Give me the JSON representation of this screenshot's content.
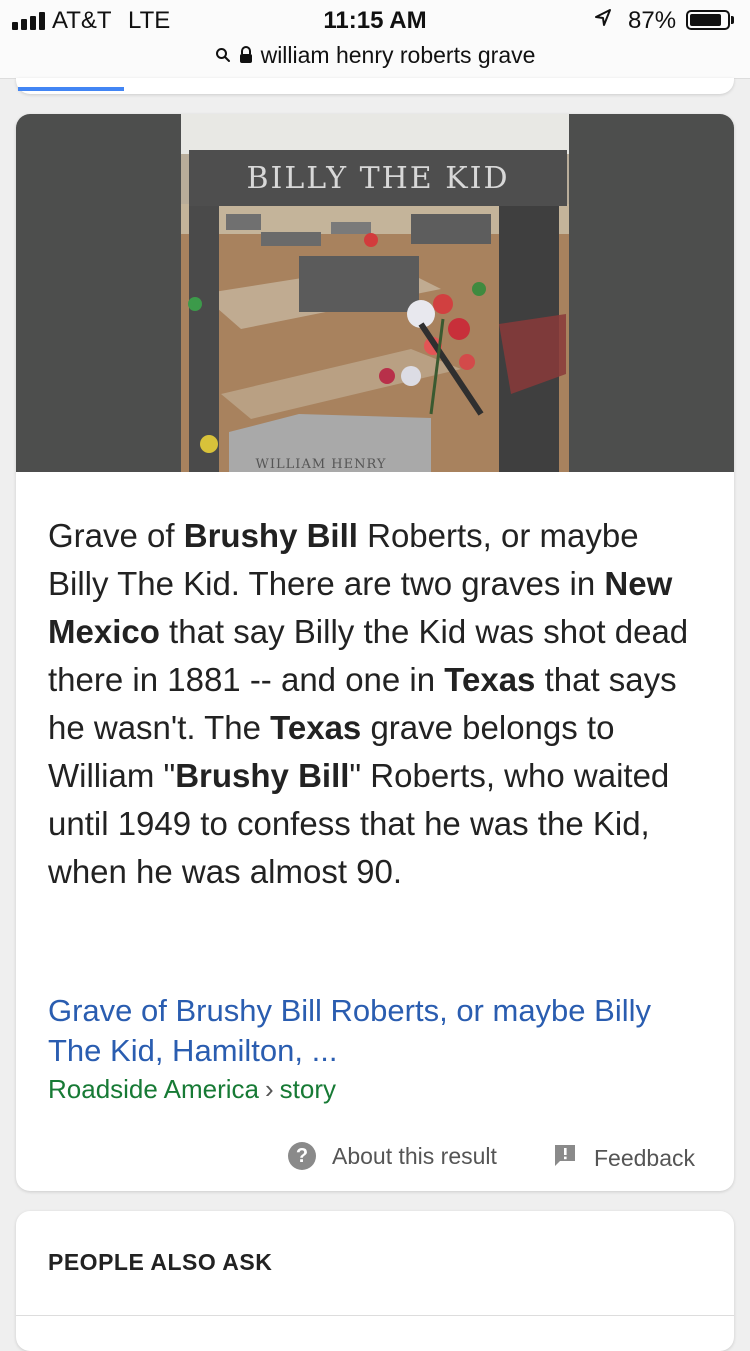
{
  "status_bar": {
    "carrier": "AT&T",
    "network": "LTE",
    "time": "11:15 AM",
    "battery_percent_text": "87%",
    "battery_level": 0.87
  },
  "url_bar": {
    "query": "william henry roberts grave"
  },
  "result": {
    "image": {
      "top_text": "BILLY THE KID",
      "stone_text": "WILLIAM HENRY"
    },
    "snippet": [
      {
        "text": "Grave of ",
        "bold": false
      },
      {
        "text": "Brushy Bill",
        "bold": true
      },
      {
        "text": " Roberts, or maybe Billy The Kid. There are two graves in ",
        "bold": false
      },
      {
        "text": "New Mexico",
        "bold": true
      },
      {
        "text": " that say Billy the Kid was shot dead there in 1881 -- and one in ",
        "bold": false
      },
      {
        "text": "Texas",
        "bold": true
      },
      {
        "text": " that says he wasn't. The ",
        "bold": false
      },
      {
        "text": "Texas",
        "bold": true
      },
      {
        "text": " grave belongs to William \"",
        "bold": false
      },
      {
        "text": "Brushy Bill",
        "bold": true
      },
      {
        "text": "\" Roberts, who waited until 1949 to confess that he was the Kid, when he was almost 90.",
        "bold": false
      }
    ],
    "link_title": "Grave of Brushy Bill Roberts, or maybe Billy The Kid, Hamilton, ...",
    "source_site": "Roadside America",
    "source_separator": "›",
    "source_path": "story",
    "about_label": "About this result",
    "feedback_label": "Feedback"
  },
  "people_also_ask": {
    "title": "PEOPLE ALSO ASK"
  },
  "colors": {
    "link": "#2a5db0",
    "source": "#177a35",
    "accent_tab": "#4285f4",
    "image_bg": "#4d4e4d"
  }
}
